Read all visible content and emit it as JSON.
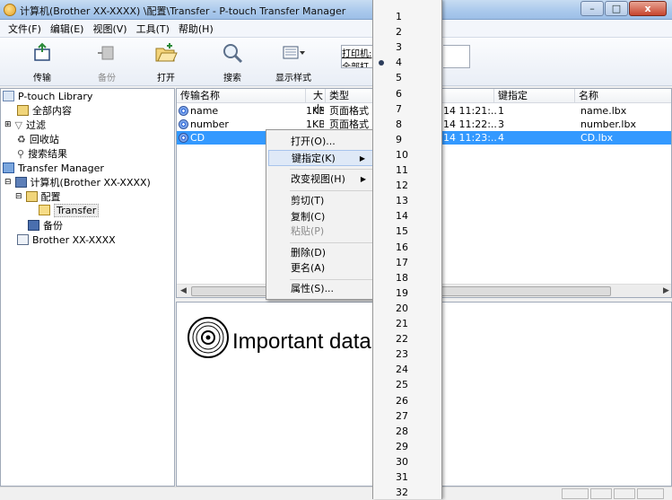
{
  "window": {
    "title": "计算机(Brother XX-XXXX) \\配置\\Transfer - P-touch Transfer Manager",
    "minimize": "–",
    "maximize": "□",
    "close": "x"
  },
  "menubar": [
    "文件(F)",
    "编辑(E)",
    "视图(V)",
    "工具(T)",
    "帮助(H)"
  ],
  "toolbar": {
    "transfer": "传输",
    "backup": "备份",
    "open": "打开",
    "search": "搜索",
    "display_style": "显示样式",
    "printer_label": "打印机:",
    "printer_value": "全部打"
  },
  "tree": {
    "library": "P-touch Library",
    "all_contents": "全部内容",
    "filter": "过滤",
    "recycle_bin": "回收站",
    "search_results": "搜索结果",
    "transfer_manager": "Transfer Manager",
    "computer": "计算机(Brother XX-XXXX)",
    "config": "配置",
    "transfer": "Transfer",
    "backup": "备份",
    "printer": "Brother XX-XXXX"
  },
  "list": {
    "columns": {
      "name": "传输名称",
      "size": "大小",
      "type": "类型",
      "key": "键指定",
      "filename": "名称"
    },
    "rows": [
      {
        "name": "name",
        "size": "1KB",
        "type": "页面格式",
        "date": "14 11:21:...",
        "key": "1",
        "filename": "name.lbx"
      },
      {
        "name": "number",
        "size": "1KB",
        "type": "页面格式",
        "date": "14 11:22:...",
        "key": "3",
        "filename": "number.lbx"
      },
      {
        "name": "CD",
        "size": "",
        "type": "",
        "date": "14 11:23:...",
        "key": "4",
        "filename": "CD.lbx"
      }
    ]
  },
  "preview": {
    "text": "Important data"
  },
  "context_menu": {
    "open": "打开(O)...",
    "key_assign": "键指定(K)",
    "change_view": "改变视图(H)",
    "cut": "剪切(T)",
    "copy": "复制(C)",
    "paste": "粘贴(P)",
    "delete": "删除(D)",
    "rename": "更名(A)",
    "properties": "属性(S)..."
  },
  "submenu": {
    "selected": "4",
    "items": [
      "1",
      "2",
      "3",
      "4",
      "5",
      "6",
      "7",
      "8",
      "9",
      "10",
      "11",
      "12",
      "13",
      "14",
      "15",
      "16",
      "17",
      "18",
      "19",
      "20",
      "21",
      "22",
      "23",
      "24",
      "25",
      "26",
      "27",
      "28",
      "29",
      "30",
      "31",
      "32"
    ]
  }
}
